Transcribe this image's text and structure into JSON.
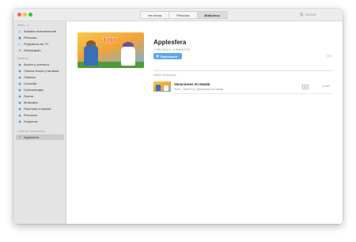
{
  "toolbar": {
    "tabs": [
      {
        "label": "Ver ahora",
        "active": false
      },
      {
        "label": "Películas",
        "active": false
      },
      {
        "label": "Biblioteca",
        "active": true
      }
    ],
    "search_placeholder": "Buscar"
  },
  "sidebar": {
    "section_library": "Biblio... ∨",
    "library_items": [
      {
        "label": "Añadido recientemente",
        "icon": "clock-icon"
      },
      {
        "label": "Películas",
        "icon": "film-icon"
      },
      {
        "label": "Programas de TV",
        "icon": "tv-icon"
      },
      {
        "label": "Descargado",
        "icon": "download-icon"
      }
    ],
    "section_genres": "Géneros",
    "genre_items": [
      {
        "label": "Acción y aventura",
        "icon": "genre-icon"
      },
      {
        "label": "Ciencia ficción y fantasía",
        "icon": "genre-icon"
      },
      {
        "label": "Clásicos",
        "icon": "genre-icon"
      },
      {
        "label": "Comedia",
        "icon": "genre-icon"
      },
      {
        "label": "Cortometrajes",
        "icon": "genre-icon"
      },
      {
        "label": "Drama",
        "icon": "genre-icon"
      },
      {
        "label": "Musicales",
        "icon": "genre-icon"
      },
      {
        "label": "Para toda la familia",
        "icon": "genre-icon"
      },
      {
        "label": "Romance",
        "icon": "genre-icon"
      },
      {
        "label": "Suspense",
        "icon": "genre-icon"
      }
    ],
    "section_playlists": "Listas de reproducción",
    "playlist_items": [
      {
        "label": "Applesfera",
        "icon": "playlist-icon",
        "selected": true
      }
    ]
  },
  "main": {
    "title": "Applesfera",
    "meta": "1 PELÍCULA · 6 MINUTOS",
    "play_label": "Reproducir",
    "more_label": "···",
    "section_label": "Añadir descripción",
    "rows": [
      {
        "title": "Vacaciones en Hawái",
        "subtitle": "Pixar · Short Fry | Vacaciones en Hawái",
        "badge": "HD",
        "duration": "6 min"
      }
    ]
  },
  "colors": {
    "accent": "#5aa9ea",
    "sidebar_bg": "#e4e4e4",
    "titlebar_bg": "#ececec"
  }
}
